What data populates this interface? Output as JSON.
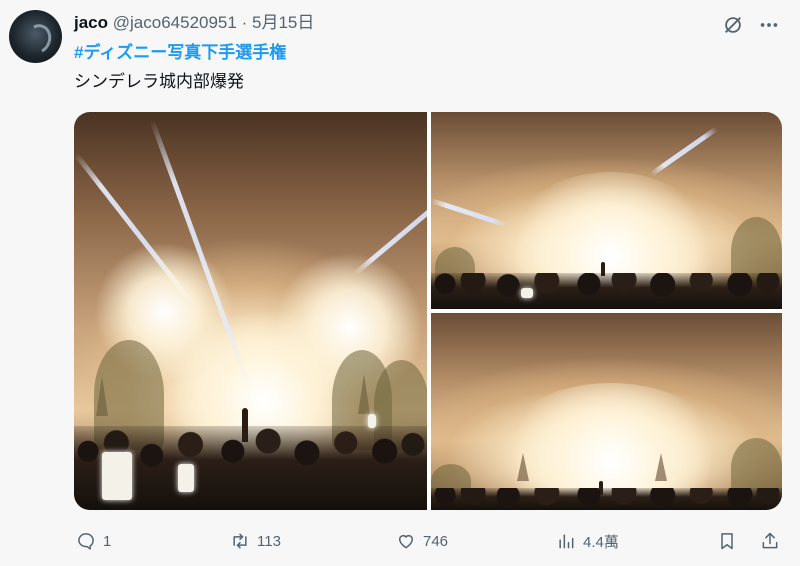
{
  "tweet": {
    "author_name": "jaco",
    "handle": "@jaco64520951",
    "separator": "·",
    "date": "5月15日",
    "hashtag": "#ディズニー写真下手選手権",
    "text": "シンデレラ城内部爆発"
  },
  "icons": {
    "grok": "grok-icon",
    "more": "more-icon",
    "reply": "reply-icon",
    "retweet": "retweet-icon",
    "like": "like-icon",
    "views": "views-icon",
    "bookmark": "bookmark-icon",
    "share": "share-icon"
  },
  "stats": {
    "replies": "1",
    "retweets": "113",
    "likes": "746",
    "views": "4.4萬"
  },
  "colors": {
    "link": "#1d9bf0",
    "secondary_text": "#536471",
    "background": "#f7f7f8"
  }
}
